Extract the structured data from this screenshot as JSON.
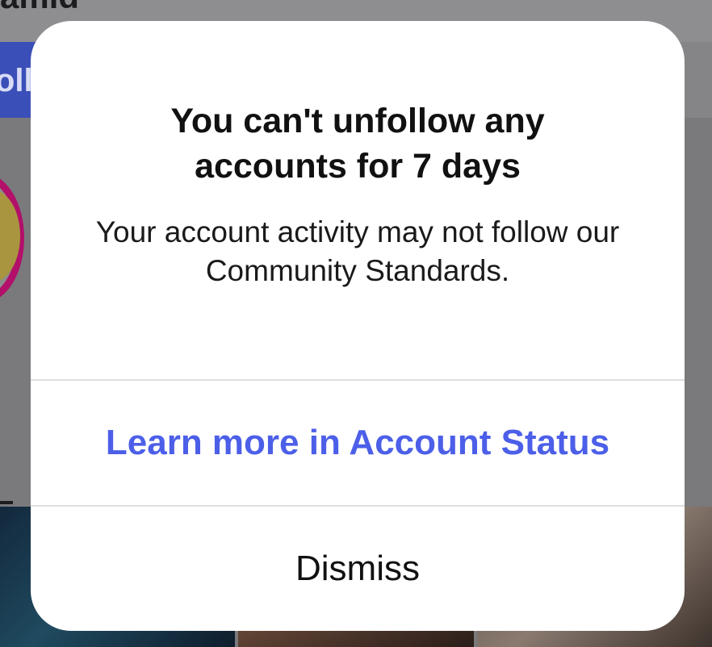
{
  "background": {
    "title_fragment": "amid",
    "follow_button_fragment": "ollo"
  },
  "alert": {
    "title": "You can't unfollow any accounts for 7 days",
    "message": "Your account activity may not follow our Community Standards.",
    "primary_action": "Learn more in Account Status",
    "secondary_action": "Dismiss",
    "accent_color": "#4c5fe8"
  }
}
